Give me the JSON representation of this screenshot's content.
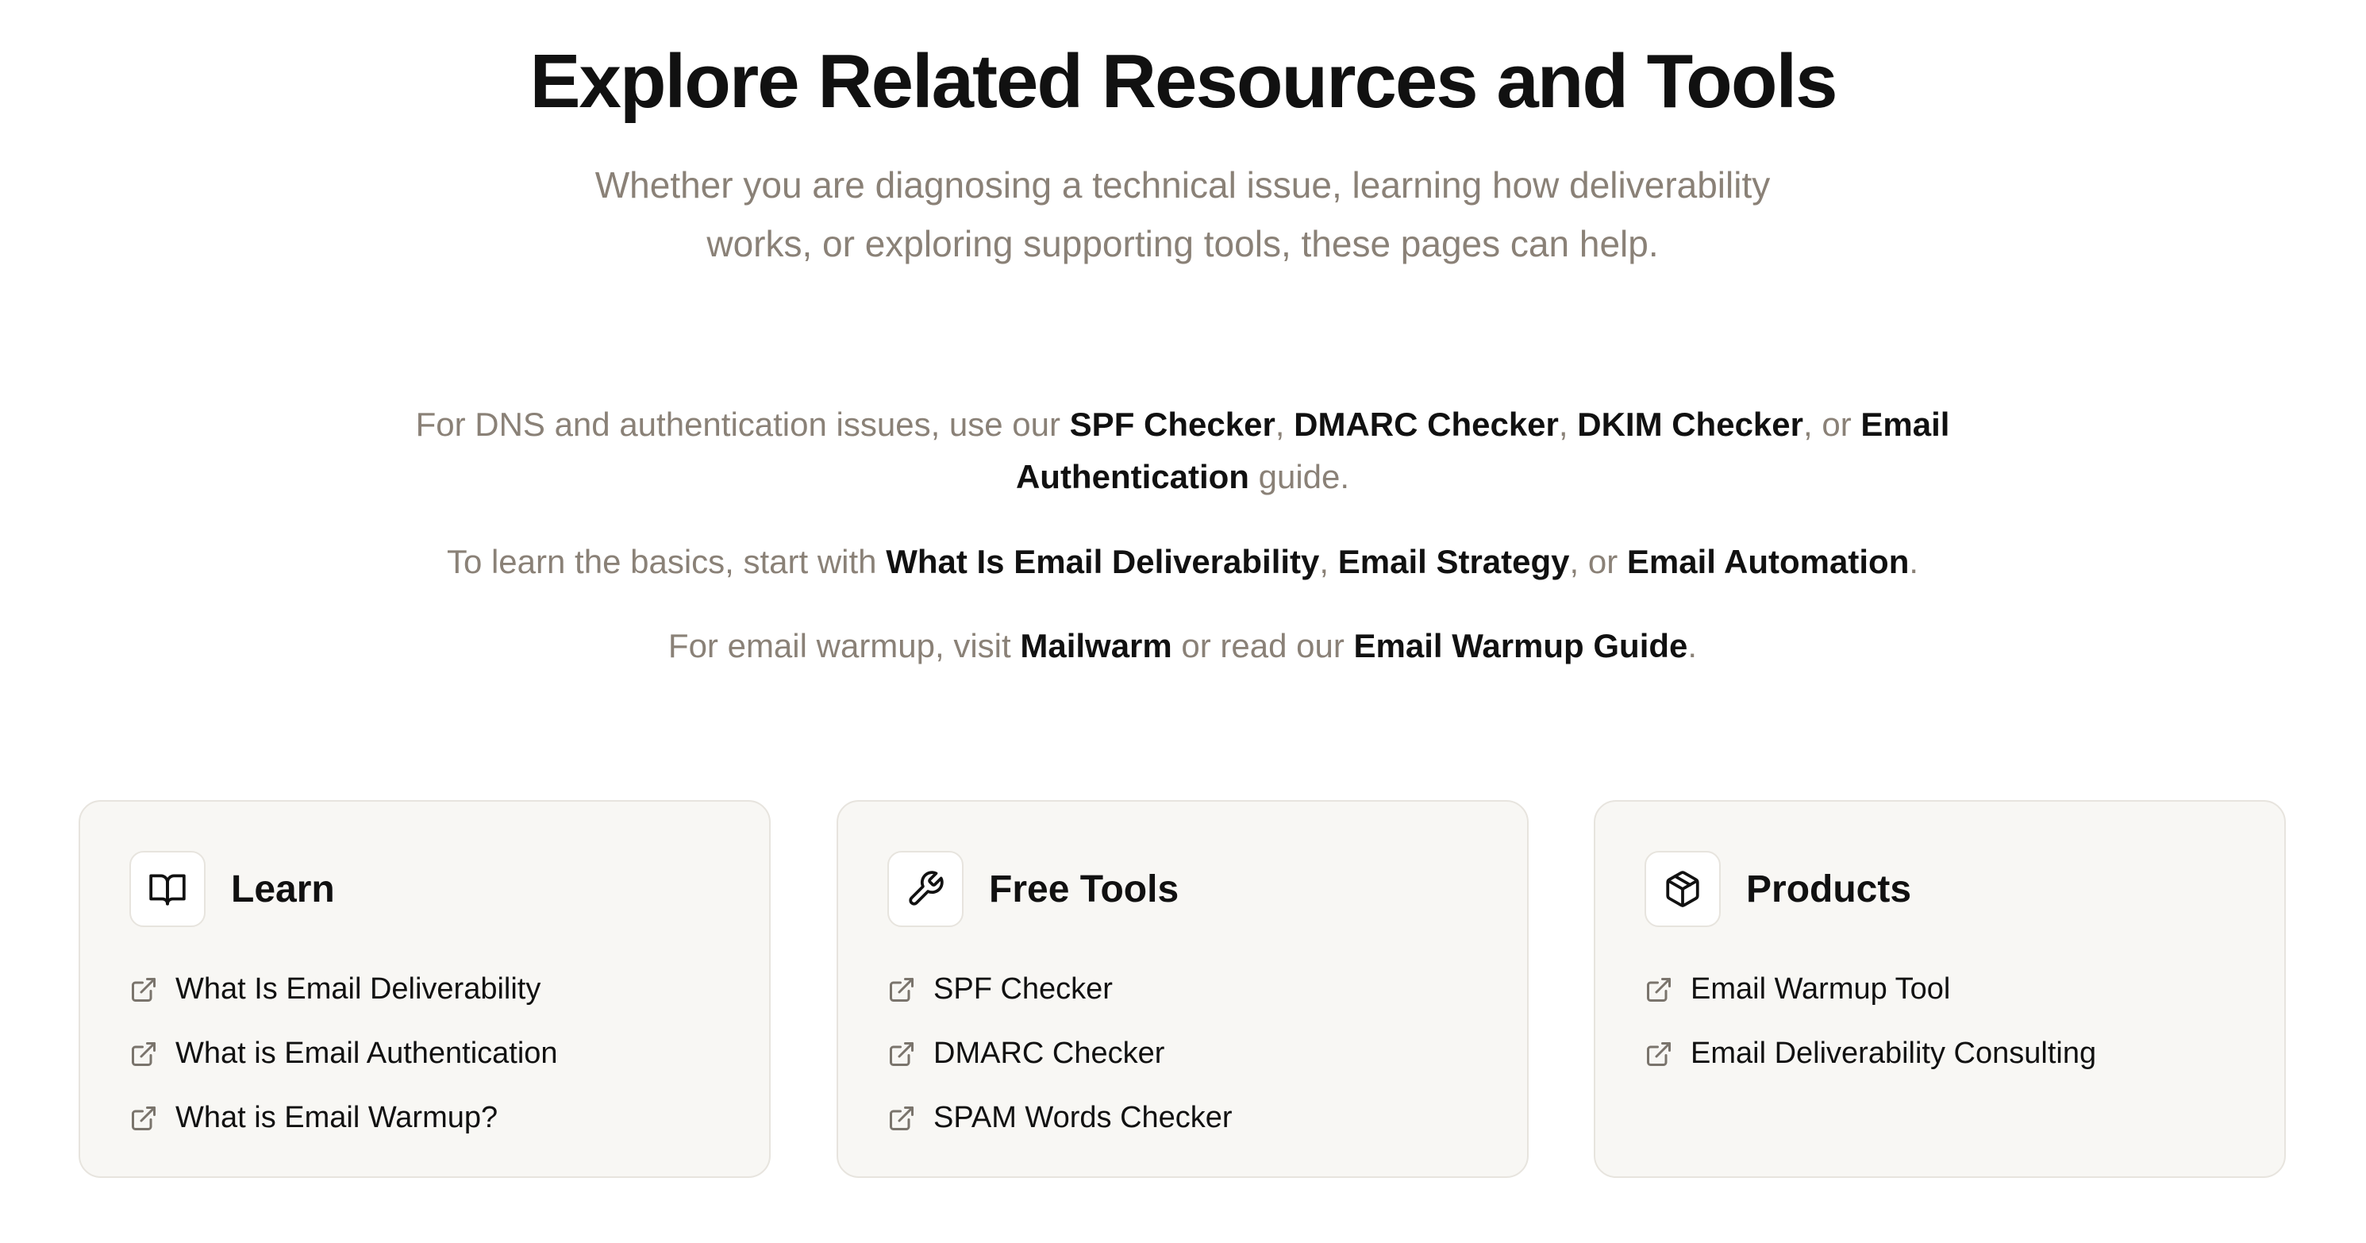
{
  "header": {
    "title": "Explore Related Resources and Tools",
    "subtitle_line1": "Whether you are diagnosing a technical issue, learning how deliverability",
    "subtitle_line2": "works, or exploring supporting tools, these pages can help."
  },
  "paragraph_dns": {
    "prefix": "For DNS and authentication issues, use our ",
    "link_spf": "SPF Checker",
    "sep1": ", ",
    "link_dmarc": "DMARC Checker",
    "sep2": ", ",
    "link_dkim": "DKIM Checker",
    "sep3": ", or ",
    "link_auth": "Email Authentication",
    "suffix": " guide."
  },
  "paragraph_basics": {
    "prefix": "To learn the basics, start with ",
    "link_deliverability": "What Is Email Deliverability",
    "sep1": ", ",
    "link_strategy": "Email Strategy",
    "sep2": ", or ",
    "link_automation": "Email Automation",
    "suffix": "."
  },
  "paragraph_warmup": {
    "prefix": "For email warmup, visit ",
    "link_mailwarm": "Mailwarm",
    "middle": " or read our ",
    "link_guide": "Email Warmup Guide",
    "suffix": "."
  },
  "cards": [
    {
      "title": "Learn",
      "icon": "book-icon",
      "links": [
        "What Is Email Deliverability",
        "What is Email Authentication",
        "What is Email Warmup?"
      ]
    },
    {
      "title": "Free Tools",
      "icon": "wrench-icon",
      "links": [
        "SPF Checker",
        "DMARC Checker",
        "SPAM Words Checker"
      ]
    },
    {
      "title": "Products",
      "icon": "box-icon",
      "links": [
        "Email Warmup Tool",
        "Email Deliverability Consulting"
      ]
    }
  ],
  "colors": {
    "heading": "#111111",
    "muted_text": "#8a8177",
    "card_bg": "#f8f7f4",
    "card_border": "#e7e4de"
  }
}
